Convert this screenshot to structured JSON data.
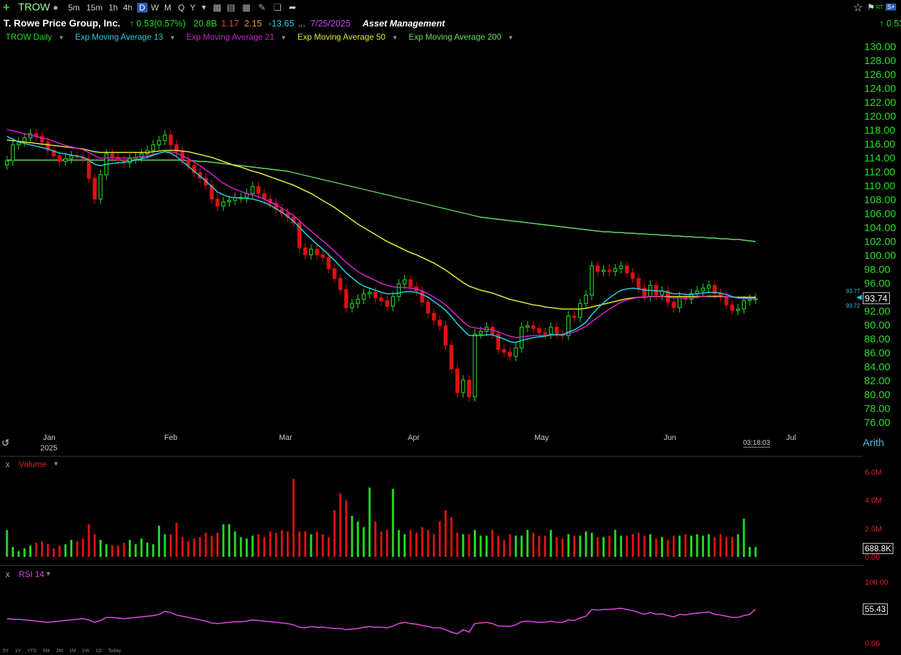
{
  "toolbar": {
    "symbol": "TROW",
    "timeframes": [
      "5m",
      "15m",
      "1h",
      "4h",
      "D",
      "W",
      "M",
      "Q",
      "Y"
    ],
    "active_timeframe": "D"
  },
  "header": {
    "company": "T. Rowe Price Group, Inc.",
    "change": "0.53(0.57%)",
    "market_cap": "20.8B",
    "val1": "1.17",
    "val2": "2.15",
    "val3": "-13.65",
    "ellipsis": "...",
    "date": "7/25/2025",
    "industry": "Asset Management",
    "right_change": "0.53"
  },
  "legend": {
    "items": [
      {
        "label": "TROW Daily",
        "color": "#22dd22"
      },
      {
        "label": "Exp Moving Average 13",
        "color": "#22cfe0"
      },
      {
        "label": "Exp Moving Average 21",
        "color": "#cc22cc"
      },
      {
        "label": "Exp Moving Average 50",
        "color": "#e8e830"
      },
      {
        "label": "Exp Moving Average 200",
        "color": "#66dd66"
      }
    ]
  },
  "price_axis": {
    "ticks": [
      "130.00",
      "128.00",
      "126.00",
      "124.00",
      "122.00",
      "120.00",
      "118.00",
      "116.00",
      "114.00",
      "112.00",
      "110.00",
      "108.00",
      "106.00",
      "104.00",
      "102.00",
      "100.00",
      "98.00",
      "96.00",
      "94.00",
      "92.00",
      "90.00",
      "88.00",
      "86.00",
      "84.00",
      "82.00",
      "80.00",
      "78.00",
      "76.00"
    ],
    "last_price": "93.74",
    "ema13_value": "93.77",
    "ema21_value": "93.72",
    "scale": "Arith"
  },
  "time_axis": {
    "labels": [
      "Jan",
      "Feb",
      "Mar",
      "Apr",
      "May",
      "Jun",
      "Jul"
    ],
    "year": "2025",
    "clock": "03:18:03"
  },
  "volume_panel": {
    "label": "Volume",
    "ticks": [
      "6.0M",
      "4.0M",
      "2.0M",
      "0.00"
    ],
    "last": "688.8K"
  },
  "rsi_panel": {
    "label": "RSI 14",
    "ticks": [
      "100.00",
      "0.00"
    ],
    "last": "55.43"
  },
  "bottom_ranges": [
    "5Y",
    "1Y",
    "YTD",
    "6M",
    "3M",
    "1M",
    "1W",
    "1D",
    "Today"
  ],
  "colors": {
    "up": "#22dd22",
    "down": "#dd1111",
    "bg": "#000000",
    "axis_text": "#22dd22",
    "rsi": "#dd44dd"
  },
  "chart_data": {
    "type": "candlestick",
    "x": [
      "2024-12-16",
      "2024-12-17",
      "2024-12-18",
      "2024-12-19",
      "2024-12-20",
      "2024-12-23",
      "2024-12-24",
      "2024-12-26",
      "2024-12-27",
      "2024-12-30",
      "2024-12-31",
      "2025-01-02",
      "2025-01-03",
      "2025-01-06",
      "2025-01-07",
      "2025-01-08",
      "2025-01-10",
      "2025-01-13",
      "2025-01-14",
      "2025-01-15",
      "2025-01-16",
      "2025-01-17",
      "2025-01-21",
      "2025-01-22",
      "2025-01-23",
      "2025-01-24",
      "2025-01-27",
      "2025-01-28",
      "2025-01-29",
      "2025-01-30",
      "2025-01-31",
      "2025-02-03",
      "2025-02-04",
      "2025-02-05",
      "2025-02-06",
      "2025-02-07",
      "2025-02-10",
      "2025-02-11",
      "2025-02-12",
      "2025-02-13",
      "2025-02-14",
      "2025-02-18",
      "2025-02-19",
      "2025-02-20",
      "2025-02-21",
      "2025-02-24",
      "2025-02-25",
      "2025-02-26",
      "2025-02-27",
      "2025-02-28",
      "2025-03-03",
      "2025-03-04",
      "2025-03-05",
      "2025-03-06",
      "2025-03-07",
      "2025-03-10",
      "2025-03-11",
      "2025-03-12",
      "2025-03-13",
      "2025-03-14",
      "2025-03-17",
      "2025-03-18",
      "2025-03-19",
      "2025-03-20",
      "2025-03-21",
      "2025-03-24",
      "2025-03-25",
      "2025-03-26",
      "2025-03-27",
      "2025-03-28",
      "2025-03-31",
      "2025-04-01",
      "2025-04-02",
      "2025-04-03",
      "2025-04-04",
      "2025-04-07",
      "2025-04-08",
      "2025-04-09",
      "2025-04-10",
      "2025-04-11",
      "2025-04-14",
      "2025-04-15",
      "2025-04-16",
      "2025-04-17",
      "2025-04-21",
      "2025-04-22",
      "2025-04-23",
      "2025-04-24",
      "2025-04-25",
      "2025-04-28",
      "2025-04-29",
      "2025-04-30",
      "2025-05-01",
      "2025-05-02",
      "2025-05-05",
      "2025-05-06",
      "2025-05-07",
      "2025-05-08",
      "2025-05-09",
      "2025-05-12",
      "2025-05-13",
      "2025-05-14",
      "2025-05-15",
      "2025-05-16",
      "2025-05-19",
      "2025-05-20",
      "2025-05-21",
      "2025-05-22",
      "2025-05-23",
      "2025-05-27",
      "2025-05-28",
      "2025-05-29",
      "2025-05-30",
      "2025-06-02",
      "2025-06-03",
      "2025-06-04",
      "2025-06-05",
      "2025-06-06",
      "2025-06-09",
      "2025-06-10",
      "2025-06-11",
      "2025-06-12",
      "2025-06-13",
      "2025-06-16",
      "2025-06-17",
      "2025-06-18",
      "2025-06-20",
      "2025-06-23",
      "2025-06-24",
      "2025-06-25",
      "2025-06-26",
      "2025-06-27"
    ],
    "close": [
      113.5,
      115.8,
      116.2,
      116.8,
      117.4,
      117.0,
      116.2,
      115.0,
      114.2,
      113.4,
      113.8,
      114.2,
      114.0,
      113.8,
      111.0,
      108.0,
      111.5,
      114.5,
      114.0,
      113.6,
      113.2,
      113.8,
      114.0,
      114.5,
      115.0,
      115.8,
      116.4,
      117.2,
      115.8,
      114.8,
      113.6,
      112.8,
      111.8,
      111.0,
      110.0,
      108.0,
      107.0,
      107.6,
      107.8,
      108.2,
      108.2,
      108.8,
      109.8,
      108.8,
      108.0,
      107.4,
      106.6,
      106.0,
      105.4,
      104.6,
      101.0,
      100.0,
      100.8,
      100.0,
      99.6,
      98.0,
      96.6,
      95.0,
      92.4,
      93.0,
      93.6,
      94.4,
      94.6,
      93.8,
      93.4,
      92.6,
      94.0,
      95.8,
      96.4,
      95.4,
      94.8,
      93.2,
      91.6,
      90.6,
      89.8,
      87.0,
      83.6,
      80.2,
      82.0,
      79.6,
      88.6,
      89.0,
      89.6,
      88.6,
      86.4,
      86.0,
      85.4,
      86.6,
      89.6,
      89.8,
      89.4,
      88.8,
      88.6,
      89.6,
      88.6,
      88.4,
      91.2,
      91.0,
      93.0,
      94.2,
      98.4,
      97.6,
      97.8,
      97.6,
      98.0,
      98.4,
      97.4,
      96.6,
      95.2,
      94.0,
      95.6,
      94.2,
      94.8,
      93.2,
      92.4,
      94.0,
      93.6,
      94.4,
      94.8,
      95.2,
      95.6,
      94.4,
      94.0,
      92.8,
      92.0,
      92.2,
      93.4,
      93.6,
      93.7
    ],
    "ema13_values": [
      117.0,
      116.6,
      116.2,
      116.0,
      115.8,
      115.6,
      115.4,
      115.2,
      114.9,
      114.6,
      114.5,
      114.3,
      114.2,
      114.0,
      113.6,
      113.0,
      112.8,
      113.0,
      113.1,
      113.2,
      113.3,
      113.4,
      113.6,
      113.8,
      114.0,
      114.3,
      114.6,
      114.8,
      114.6,
      114.1,
      113.4,
      112.7,
      112.0,
      111.3,
      110.6,
      109.8,
      109.0,
      108.6,
      108.3,
      108.2,
      108.2,
      108.1,
      108.0,
      107.8,
      107.5,
      107.1,
      106.6,
      106.1,
      105.5,
      104.8,
      104.0,
      103.1,
      102.3,
      101.5,
      100.8,
      100.0,
      99.2,
      98.3,
      97.4,
      96.7,
      96.0,
      95.5,
      95.2,
      94.9,
      94.6,
      94.4,
      94.4,
      94.5,
      94.7,
      94.7,
      94.6,
      94.3,
      93.9,
      93.3,
      92.7,
      92.0,
      91.1,
      90.1,
      89.2,
      88.4,
      88.4,
      88.4,
      88.5,
      88.5,
      88.2,
      87.9,
      87.5,
      87.4,
      87.7,
      87.9,
      88.1,
      88.2,
      88.3,
      88.5,
      88.5,
      88.5,
      88.9,
      89.2,
      89.7,
      90.3,
      91.4,
      92.3,
      93.1,
      93.8,
      94.4,
      94.9,
      95.1,
      95.2,
      95.1,
      94.9,
      94.9,
      94.8,
      94.8,
      94.6,
      94.4,
      94.4,
      94.3,
      94.3,
      94.4,
      94.5,
      94.6,
      94.6,
      94.5,
      94.3,
      94.0,
      93.8,
      93.8,
      93.8,
      93.77
    ],
    "ema21_values": [
      118.0,
      117.8,
      117.6,
      117.4,
      117.2,
      117.0,
      116.8,
      116.6,
      116.3,
      116.0,
      115.7,
      115.5,
      115.3,
      115.1,
      114.7,
      114.2,
      113.9,
      113.9,
      113.9,
      113.9,
      113.9,
      113.9,
      114.0,
      114.1,
      114.2,
      114.4,
      114.6,
      114.8,
      114.8,
      114.6,
      114.2,
      113.8,
      113.3,
      112.8,
      112.2,
      111.6,
      110.9,
      110.3,
      109.8,
      109.4,
      109.1,
      108.8,
      108.6,
      108.3,
      108.0,
      107.6,
      107.2,
      106.7,
      106.2,
      105.6,
      104.9,
      104.1,
      103.4,
      102.7,
      102.0,
      101.3,
      100.5,
      99.7,
      98.9,
      98.2,
      97.6,
      97.1,
      96.7,
      96.3,
      95.9,
      95.6,
      95.4,
      95.3,
      95.3,
      95.2,
      95.1,
      94.8,
      94.4,
      93.9,
      93.4,
      92.8,
      92.0,
      91.2,
      90.4,
      89.7,
      89.5,
      89.4,
      89.3,
      89.2,
      88.9,
      88.6,
      88.3,
      88.1,
      88.2,
      88.3,
      88.4,
      88.4,
      88.4,
      88.5,
      88.5,
      88.5,
      88.7,
      88.9,
      89.3,
      89.7,
      90.4,
      91.0,
      91.6,
      92.2,
      92.7,
      93.2,
      93.5,
      93.7,
      93.9,
      93.9,
      94.0,
      94.0,
      94.0,
      93.9,
      93.8,
      93.8,
      93.8,
      93.8,
      93.9,
      94.0,
      94.1,
      94.1,
      94.1,
      94.0,
      93.9,
      93.8,
      93.7,
      93.7,
      93.72
    ],
    "ema50_values": [
      116.5,
      116.4,
      116.3,
      116.2,
      116.1,
      116.0,
      115.9,
      115.8,
      115.7,
      115.6,
      115.5,
      115.4,
      115.3,
      115.2,
      115.0,
      114.8,
      114.7,
      114.7,
      114.7,
      114.7,
      114.7,
      114.7,
      114.7,
      114.7,
      114.7,
      114.8,
      114.9,
      115.0,
      115.0,
      115.0,
      114.9,
      114.8,
      114.6,
      114.4,
      114.2,
      114.0,
      113.7,
      113.4,
      113.1,
      112.8,
      112.6,
      112.3,
      112.0,
      111.8,
      111.5,
      111.2,
      110.9,
      110.6,
      110.3,
      110.0,
      109.6,
      109.2,
      108.8,
      108.3,
      107.8,
      107.3,
      106.8,
      106.2,
      105.6,
      105.0,
      104.4,
      103.9,
      103.4,
      102.9,
      102.4,
      101.9,
      101.5,
      101.1,
      100.7,
      100.3,
      100.0,
      99.6,
      99.2,
      98.8,
      98.3,
      97.8,
      97.2,
      96.6,
      96.0,
      95.5,
      95.2,
      94.9,
      94.7,
      94.5,
      94.2,
      93.9,
      93.6,
      93.4,
      93.2,
      93.0,
      92.8,
      92.7,
      92.5,
      92.4,
      92.3,
      92.2,
      92.2,
      92.2,
      92.2,
      92.3,
      92.5,
      92.7,
      92.9,
      93.1,
      93.3,
      93.5,
      93.7,
      93.8,
      93.9,
      93.9,
      94.0,
      94.0,
      94.0,
      94.0,
      94.0,
      94.0,
      94.0,
      94.0,
      94.0,
      94.0,
      94.0,
      94.0,
      94.0,
      94.0,
      93.9,
      93.9,
      93.9,
      93.9,
      93.9
    ],
    "ema200_values": [
      113.6,
      113.6,
      113.6,
      113.6,
      113.6,
      113.6,
      113.6,
      113.6,
      113.6,
      113.6,
      113.6,
      113.6,
      113.6,
      113.6,
      113.6,
      113.6,
      113.6,
      113.6,
      113.6,
      113.6,
      113.6,
      113.6,
      113.6,
      113.6,
      113.6,
      113.6,
      113.6,
      113.6,
      113.6,
      113.6,
      113.6,
      113.5,
      113.5,
      113.4,
      113.4,
      113.3,
      113.2,
      113.1,
      113.0,
      112.9,
      112.8,
      112.7,
      112.6,
      112.5,
      112.4,
      112.3,
      112.2,
      112.1,
      112.0,
      111.8,
      111.6,
      111.4,
      111.2,
      111.0,
      110.8,
      110.6,
      110.4,
      110.2,
      110.0,
      109.8,
      109.6,
      109.4,
      109.2,
      109.0,
      108.8,
      108.6,
      108.4,
      108.2,
      108.0,
      107.8,
      107.6,
      107.4,
      107.2,
      107.0,
      106.8,
      106.6,
      106.4,
      106.2,
      106.0,
      105.8,
      105.6,
      105.4,
      105.3,
      105.2,
      105.1,
      105.0,
      104.9,
      104.8,
      104.7,
      104.6,
      104.5,
      104.4,
      104.3,
      104.2,
      104.1,
      104.0,
      103.9,
      103.8,
      103.7,
      103.6,
      103.5,
      103.4,
      103.3,
      103.3,
      103.2,
      103.2,
      103.1,
      103.1,
      103.0,
      103.0,
      102.9,
      102.9,
      102.8,
      102.8,
      102.7,
      102.7,
      102.6,
      102.6,
      102.5,
      102.5,
      102.4,
      102.4,
      102.3,
      102.3,
      102.2,
      102.2,
      102.1,
      102.0,
      101.9
    ],
    "volume_millions": [
      1.9,
      0.7,
      0.4,
      0.6,
      0.8,
      1.0,
      1.1,
      0.9,
      0.6,
      0.8,
      0.9,
      1.2,
      1.1,
      1.3,
      2.3,
      1.6,
      1.2,
      0.9,
      0.8,
      0.8,
      1.0,
      1.2,
      0.9,
      1.3,
      1.0,
      0.9,
      2.2,
      1.6,
      1.6,
      2.4,
      1.4,
      1.1,
      1.3,
      1.4,
      1.7,
      1.5,
      1.7,
      2.3,
      2.3,
      1.8,
      1.4,
      1.3,
      1.5,
      1.6,
      1.4,
      1.8,
      1.7,
      1.9,
      1.8,
      5.5,
      1.8,
      1.8,
      1.6,
      1.8,
      1.6,
      1.4,
      3.3,
      4.5,
      4.0,
      2.9,
      2.5,
      2.1,
      4.9,
      2.5,
      1.8,
      1.9,
      4.8,
      1.9,
      1.6,
      1.9,
      1.7,
      2.1,
      1.9,
      1.6,
      2.5,
      3.3,
      2.8,
      1.7,
      1.6,
      1.6,
      1.9,
      1.5,
      1.5,
      1.9,
      1.5,
      1.2,
      1.6,
      1.5,
      1.5,
      1.9,
      1.7,
      1.5,
      1.5,
      1.9,
      1.4,
      1.3,
      1.6,
      1.5,
      1.5,
      1.8,
      1.7,
      1.4,
      1.4,
      1.5,
      1.9,
      1.5,
      1.5,
      1.6,
      1.7,
      1.5,
      1.6,
      1.3,
      1.4,
      1.2,
      1.5,
      1.5,
      1.6,
      1.5,
      1.6,
      1.5,
      1.6,
      1.4,
      1.6,
      1.4,
      1.4,
      1.6,
      2.7,
      0.7,
      0.69
    ],
    "rsi_values": [
      40,
      39,
      39,
      38,
      37,
      36,
      35,
      34,
      35,
      36,
      37,
      38,
      39,
      40,
      38,
      34,
      37,
      42,
      42,
      41,
      40,
      41,
      42,
      43,
      44,
      45,
      47,
      52,
      50,
      46,
      44,
      42,
      40,
      38,
      36,
      33,
      32,
      33,
      34,
      35,
      35,
      36,
      38,
      37,
      36,
      35,
      34,
      33,
      32,
      30,
      26,
      25,
      27,
      26,
      26,
      25,
      24,
      24,
      22,
      23,
      24,
      26,
      27,
      26,
      26,
      25,
      28,
      32,
      34,
      32,
      31,
      29,
      27,
      25,
      25,
      22,
      18,
      15,
      22,
      18,
      32,
      33,
      34,
      32,
      28,
      28,
      27,
      30,
      35,
      36,
      35,
      34,
      34,
      36,
      34,
      34,
      38,
      37,
      41,
      44,
      55,
      54,
      55,
      55,
      56,
      57,
      55,
      53,
      50,
      47,
      50,
      47,
      48,
      45,
      43,
      47,
      46,
      48,
      49,
      50,
      51,
      47,
      46,
      44,
      42,
      42,
      45,
      47,
      55.43
    ],
    "ylim": [
      76,
      130
    ],
    "volume_ylim": [
      0,
      6
    ],
    "rsi_ylim": [
      0,
      100
    ]
  }
}
